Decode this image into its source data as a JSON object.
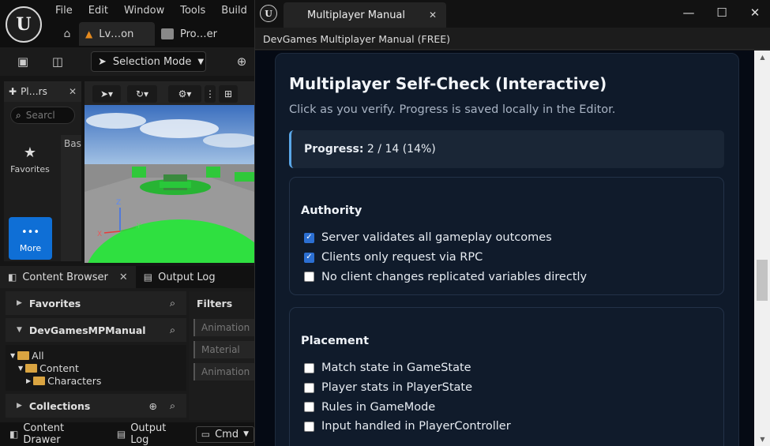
{
  "editor": {
    "menu": [
      "File",
      "Edit",
      "Window",
      "Tools",
      "Build"
    ],
    "tabs": [
      {
        "label": "Lv…on",
        "icon": "level-icon"
      },
      {
        "label": "Pro…er",
        "icon": "project-icon"
      }
    ],
    "selection_mode": "Selection Mode",
    "place_panel": {
      "tab_label": "Pl…rs",
      "search_placeholder": "Searcl",
      "favorites_label": "Favorites",
      "more_label": "More",
      "basic_label": "Basi"
    },
    "content_browser": {
      "tab_label": "Content Browser",
      "output_log_label": "Output Log",
      "favorites_label": "Favorites",
      "project_label": "DevGamesMPManual",
      "tree": {
        "all": "All",
        "content": "Content",
        "characters": "Characters"
      },
      "collections_label": "Collections",
      "filters_label": "Filters",
      "filter_chips": [
        "Animation",
        "Material",
        "Animation"
      ]
    },
    "bottom_bar": {
      "content_drawer": "Content Drawer",
      "output_log": "Output Log",
      "cmd": "Cmd"
    }
  },
  "manual_window": {
    "tab_title": "Multiplayer Manual",
    "subtitle": "DevGames Multiplayer Manual (FREE)",
    "card": {
      "title": "Multiplayer Self-Check (Interactive)",
      "description": "Click as you verify. Progress is saved locally in the Editor.",
      "progress_label": "Progress:",
      "progress_value": "2 / 14 (14%)",
      "progress_fraction": 0.14
    },
    "sections": [
      {
        "title": "Authority",
        "items": [
          {
            "label": "Server validates all gameplay outcomes",
            "checked": true
          },
          {
            "label": "Clients only request via RPC",
            "checked": true
          },
          {
            "label": "No client changes replicated variables directly",
            "checked": false
          }
        ]
      },
      {
        "title": "Placement",
        "items": [
          {
            "label": "Match state in GameState",
            "checked": false
          },
          {
            "label": "Player stats in PlayerState",
            "checked": false
          },
          {
            "label": "Rules in GameMode",
            "checked": false
          },
          {
            "label": "Input handled in PlayerController",
            "checked": false
          }
        ]
      }
    ]
  },
  "colors": {
    "accent_blue": "#2c6fd2",
    "progress_border": "#5aa7e8",
    "more_button": "#0f6fd6",
    "level_tab_icon": "#e58a1e"
  }
}
